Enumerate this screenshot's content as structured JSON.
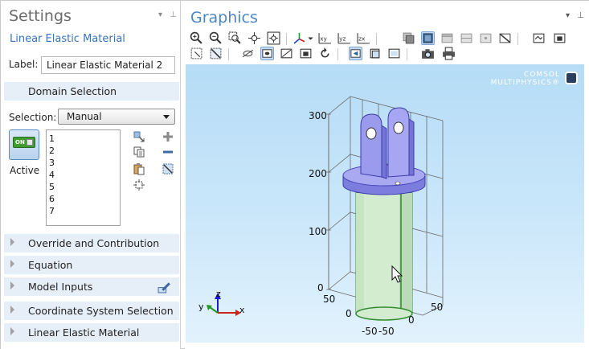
{
  "settings": {
    "title": "Settings",
    "subtitle": "Linear Elastic Material",
    "panel_controls": "▾ ⊥",
    "label_caption": "Label:",
    "label_value": "Linear Elastic Material 2"
  },
  "domain_selection": {
    "header": "Domain Selection",
    "selection_caption": "Selection:",
    "selection_value": "Manual",
    "active_switch": "ON",
    "active_label": "Active",
    "domains": [
      "1",
      "2",
      "3",
      "4",
      "5",
      "6",
      "7"
    ]
  },
  "sections": [
    {
      "label": "Override and Contribution"
    },
    {
      "label": "Equation"
    },
    {
      "label": "Model Inputs"
    },
    {
      "label": "Coordinate System Selection"
    },
    {
      "label": "Linear Elastic Material"
    }
  ],
  "graphics": {
    "title": "Graphics",
    "window_controls": "▾ ⊥",
    "brand_line1": "COMSOL",
    "brand_line2": "MULTIPHYSICS®",
    "z_ticks": [
      "300",
      "200",
      "100",
      "0"
    ],
    "x_ticks": [
      "50",
      "0",
      "-50"
    ],
    "y_ticks": [
      "50",
      "0",
      "-50"
    ],
    "triad": {
      "x": "x",
      "y": "y",
      "z": "z"
    }
  },
  "colors": {
    "accent": "#3a73b6",
    "section_bg": "#e6eef8",
    "viewport_top": "#b5dcf6",
    "viewport_bottom": "#e2f2fd",
    "selected_blue": "#9b9bee",
    "cylinder_green": "#d3ecd0"
  }
}
